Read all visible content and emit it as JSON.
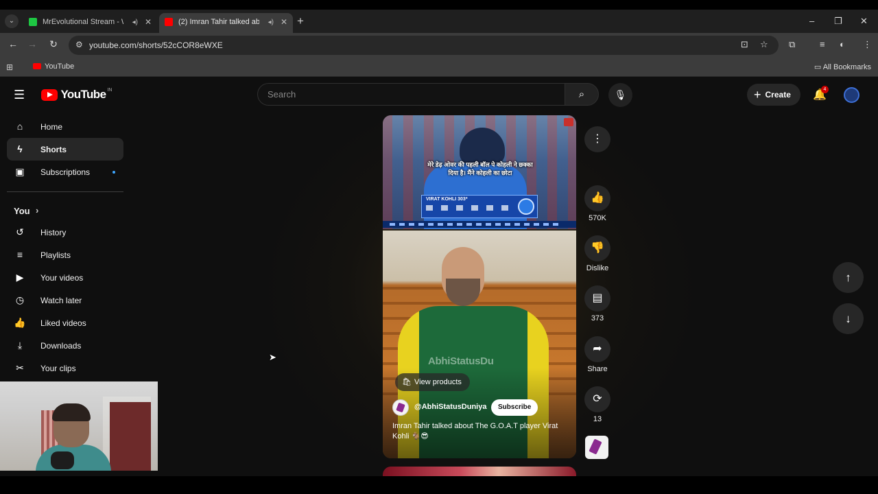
{
  "browser": {
    "tabs": [
      {
        "title": "MrEvolutional Stream - Wr",
        "active": false,
        "favicon_color": "#1ec743"
      },
      {
        "title": "(2) Imran Tahir talked abou",
        "active": true,
        "favicon_color": "#ff0000"
      }
    ],
    "new_tab": "+",
    "url": "youtube.com/shorts/52cCOR8eWXE",
    "bookmarks": [
      {
        "label": "YouTube"
      }
    ],
    "all_bookmarks": "All Bookmarks"
  },
  "youtube": {
    "logo_text": "YouTube",
    "logo_country": "IN",
    "search_placeholder": "Search",
    "create_label": "Create",
    "notification_count": "4"
  },
  "sidebar": {
    "main": [
      {
        "label": "Home",
        "icon": "home-icon"
      },
      {
        "label": "Shorts",
        "icon": "shorts-icon",
        "active": true
      },
      {
        "label": "Subscriptions",
        "icon": "subscriptions-icon"
      }
    ],
    "you_header": "You",
    "you_items": [
      {
        "label": "History",
        "icon": "history-icon"
      },
      {
        "label": "Playlists",
        "icon": "playlists-icon"
      },
      {
        "label": "Your videos",
        "icon": "your-videos-icon"
      },
      {
        "label": "Watch later",
        "icon": "watch-later-icon"
      },
      {
        "label": "Liked videos",
        "icon": "liked-videos-icon"
      },
      {
        "label": "Downloads",
        "icon": "downloads-icon"
      },
      {
        "label": "Your clips",
        "icon": "clips-icon"
      }
    ]
  },
  "short": {
    "view_products": "View products",
    "channel": "@AbhiStatusDuniya",
    "subscribe": "Subscribe",
    "caption": "Imran Tahir talked about The G.O.A.T player Virat Kohli 🐐😎",
    "watermark": "AbhiStatusDu",
    "overlay_hindi": "मेरे डेढ़ ओवर की पहली बॉल पे कोहली ने छक्का दिया है। मैंने कोहली का छोटा",
    "scorecard_title": "VIRAT KOHLI  303*"
  },
  "actions": {
    "like_count": "570K",
    "dislike_label": "Dislike",
    "comment_count": "373",
    "share_label": "Share",
    "remix_count": "13"
  }
}
